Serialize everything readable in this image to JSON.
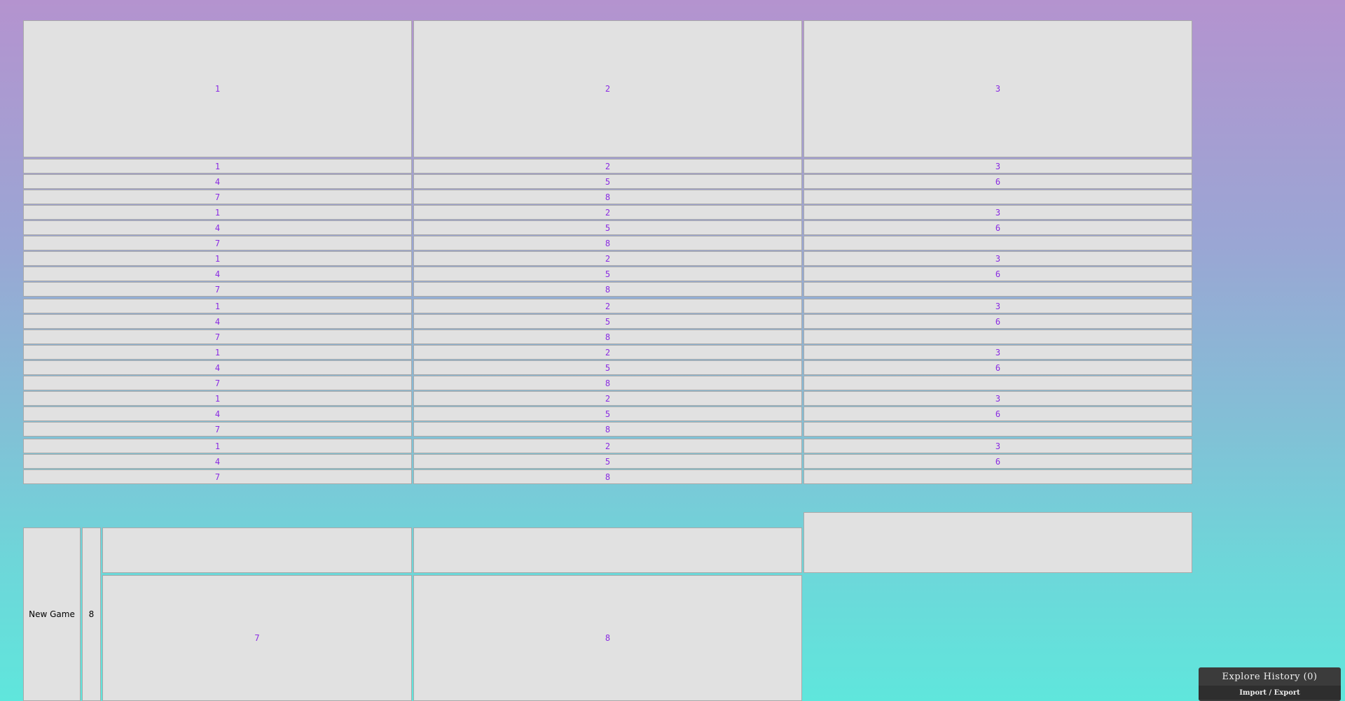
{
  "board": {
    "top_cells": [
      "1",
      "2",
      "3"
    ],
    "rows": [
      [
        "1",
        "2",
        "3"
      ],
      [
        "4",
        "5",
        "6"
      ],
      [
        "7",
        "8",
        ""
      ],
      [
        "1",
        "2",
        "3"
      ],
      [
        "4",
        "5",
        "6"
      ],
      [
        "7",
        "8",
        ""
      ],
      [
        "1",
        "2",
        "3"
      ],
      [
        "4",
        "5",
        "6"
      ],
      [
        "7",
        "8",
        ""
      ],
      [
        "1",
        "2",
        "3"
      ],
      [
        "4",
        "5",
        "6"
      ],
      [
        "7",
        "8",
        ""
      ],
      [
        "1",
        "2",
        "3"
      ],
      [
        "4",
        "5",
        "6"
      ],
      [
        "7",
        "8",
        ""
      ],
      [
        "1",
        "2",
        "3"
      ],
      [
        "4",
        "5",
        "6"
      ],
      [
        "7",
        "8",
        ""
      ],
      [
        "1",
        "2",
        "3"
      ],
      [
        "4",
        "5",
        "6"
      ],
      [
        "7",
        "8",
        ""
      ]
    ],
    "bottom_cells": [
      "7",
      "8"
    ]
  },
  "controls": {
    "new_game_label": "New Game",
    "size_value": "8"
  },
  "history": {
    "title": "Explore History (0)",
    "import_export_label": "Import / Export"
  },
  "colors": {
    "cell_text": "#8a2be2",
    "cell_bg": "#e1e1e1"
  }
}
